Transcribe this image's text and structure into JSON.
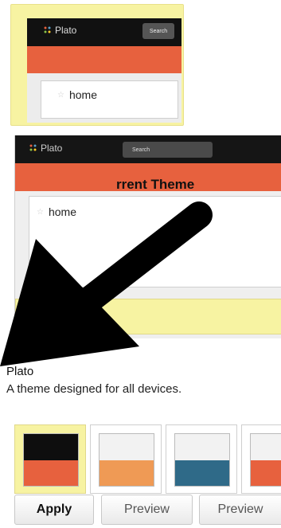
{
  "thumbnail": {
    "logo_text": "Plato",
    "search_label": "Search",
    "home_label": "home"
  },
  "preview": {
    "logo_text": "Plato",
    "search_label": "Search",
    "home_label": "home",
    "current_theme_label": "rrent Theme"
  },
  "theme": {
    "name": "Plato",
    "description": "A theme designed for all devices."
  },
  "swatches": [
    {
      "top_color": "#0e0e0e",
      "bottom_color": "#e7613e",
      "selected": true
    },
    {
      "top_color": "#f2f2f2",
      "bottom_color": "#ef9a55",
      "selected": false
    },
    {
      "top_color": "#f2f2f2",
      "bottom_color": "#2f6a88",
      "selected": false
    },
    {
      "top_color": "#f2f2f2",
      "bottom_color": "#e7613e",
      "selected": false
    }
  ],
  "buttons": {
    "apply_label": "Apply",
    "preview_label_1": "Preview",
    "preview_label_2": "Preview"
  },
  "colors": {
    "accent_orange": "#e7613e",
    "highlight_yellow": "#f7f3a2",
    "topbar": "#111111"
  },
  "icons": {
    "logo": "plato-logo-icon",
    "home": "star-icon",
    "overlay": "arrow-icon"
  }
}
